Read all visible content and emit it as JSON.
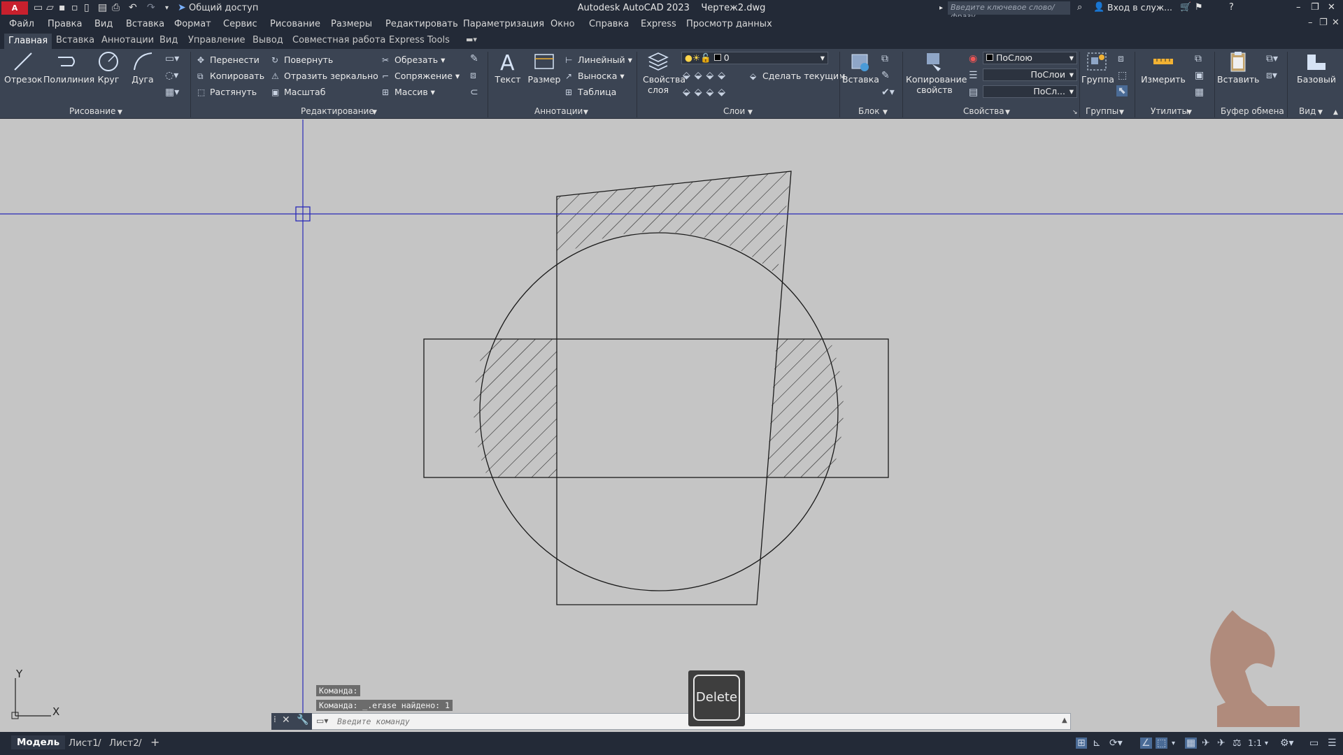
{
  "titlebar": {
    "logo": "A CAD",
    "share": "Общий доступ",
    "title": "Autodesk AutoCAD 2023",
    "file": "Чертеж2.dwg",
    "search_placeholder": "Введите ключевое слово/фразу",
    "signin": "Вход в служ..."
  },
  "menu": [
    "Файл",
    "Правка",
    "Вид",
    "Вставка",
    "Формат",
    "Сервис",
    "Рисование",
    "Размеры",
    "Редактировать",
    "Параметризация",
    "Окно",
    "Справка",
    "Express",
    "Просмотр данных"
  ],
  "ribbon_tabs": [
    "Главная",
    "Вставка",
    "Аннотации",
    "Вид",
    "Управление",
    "Вывод",
    "Совместная работа",
    "Express Tools"
  ],
  "ribbon": {
    "draw": {
      "line": "Отрезок",
      "polyline": "Полилиния",
      "circle": "Круг",
      "arc": "Дуга",
      "label": "Рисование"
    },
    "modify": {
      "move": "Перенести",
      "copy": "Копировать",
      "stretch": "Растянуть",
      "rotate": "Повернуть",
      "mirror": "Отразить зеркально",
      "scale": "Масштаб",
      "trim": "Обрезать",
      "fillet": "Сопряжение",
      "array": "Массив",
      "label": "Редактирование"
    },
    "annotation": {
      "text": "Текст",
      "dimension": "Размер",
      "linear": "Линейный",
      "leader": "Выноска",
      "table": "Таблица",
      "label": "Аннотации"
    },
    "layers": {
      "properties": "Свойства слоя",
      "current_layer": "0",
      "make_current": "Сделать текущим",
      "label": "Слои"
    },
    "block": {
      "insert": "Вставка",
      "label": "Блок"
    },
    "properties": {
      "match": "Копирование свойств",
      "color": "ПоСлою",
      "lineweight": "ПоСлои",
      "linetype": "ПоСл...",
      "label": "Свойства"
    },
    "groups": {
      "group": "Группа",
      "label": "Группы"
    },
    "utilities": {
      "measure": "Измерить",
      "label": "Утилиты"
    },
    "clipboard": {
      "paste": "Вставить",
      "label": "Буфер обмена"
    },
    "view": {
      "base": "Базовый",
      "label": "Вид"
    }
  },
  "ucs": {
    "x": "X",
    "y": "Y"
  },
  "command": {
    "history": [
      "Команда:",
      "Команда:  _.erase найдено: 1"
    ],
    "placeholder": "Введите команду"
  },
  "key_overlay": "Delete",
  "status": {
    "tabs": [
      "Модель",
      "Лист1",
      "Лист2"
    ],
    "add": "+",
    "scale": "1:1"
  }
}
